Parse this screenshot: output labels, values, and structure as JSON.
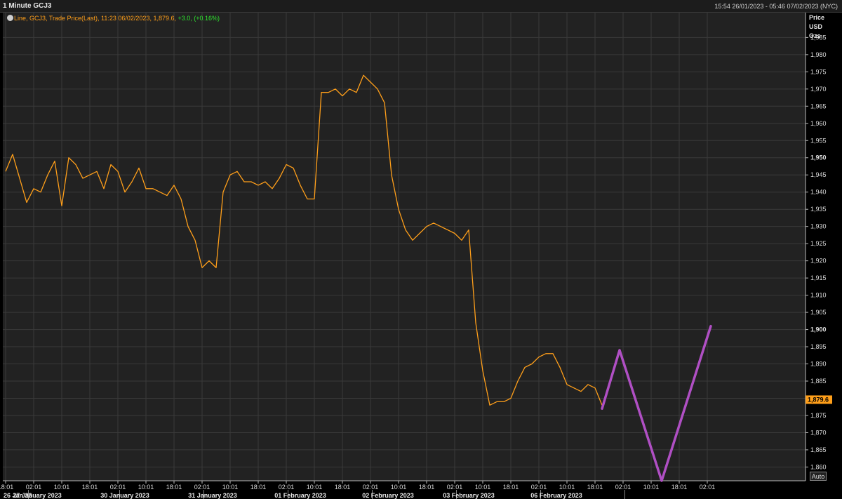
{
  "header": {
    "title": "1 Minute GCJ3",
    "time_range": "15:54 26/01/2023 - 05:46 07/02/2023 (NYC)"
  },
  "legend": {
    "icon": "chart-options-icon",
    "text": "Line, GCJ3, Trade Price(Last), 11:23 06/02/2023, 1,879.6,",
    "change": "+3.0, (+0.16%)"
  },
  "axis_header": {
    "line1": "Price",
    "line2": "USD",
    "line3": "Ozs"
  },
  "auto_label": "Auto",
  "colors": {
    "background": "#222222",
    "grid": "#3a3a3a",
    "series": "#ff9f1a",
    "annotation": "#b04fc4",
    "change_positive": "#2ee82e"
  },
  "chart_data": {
    "type": "line",
    "ylabel": "Price USD Ozs",
    "ylim": [
      1856,
      1991
    ],
    "grid": true,
    "last_value": 1879.6,
    "last_value_label": "1,879.6",
    "yticks": [
      {
        "v": 1860,
        "t": "1,860"
      },
      {
        "v": 1865,
        "t": "1,865"
      },
      {
        "v": 1870,
        "t": "1,870"
      },
      {
        "v": 1875,
        "t": "1,875"
      },
      {
        "v": 1880,
        "t": "1,880"
      },
      {
        "v": 1885,
        "t": "1,885"
      },
      {
        "v": 1890,
        "t": "1,890"
      },
      {
        "v": 1895,
        "t": "1,895"
      },
      {
        "v": 1900,
        "t": "1,900",
        "bold": true
      },
      {
        "v": 1905,
        "t": "1,905"
      },
      {
        "v": 1910,
        "t": "1,910"
      },
      {
        "v": 1915,
        "t": "1,915"
      },
      {
        "v": 1920,
        "t": "1,920"
      },
      {
        "v": 1925,
        "t": "1,925"
      },
      {
        "v": 1930,
        "t": "1,930"
      },
      {
        "v": 1935,
        "t": "1,935"
      },
      {
        "v": 1940,
        "t": "1,940"
      },
      {
        "v": 1945,
        "t": "1,945"
      },
      {
        "v": 1950,
        "t": "1,950",
        "bold": true
      },
      {
        "v": 1955,
        "t": "1,955"
      },
      {
        "v": 1960,
        "t": "1,960"
      },
      {
        "v": 1965,
        "t": "1,965"
      },
      {
        "v": 1970,
        "t": "1,970"
      },
      {
        "v": 1975,
        "t": "1,975"
      },
      {
        "v": 1980,
        "t": "1,980"
      },
      {
        "v": 1985,
        "t": "1,985"
      }
    ],
    "x_count": 114,
    "xticks": [
      {
        "i": 0,
        "t": "18:01"
      },
      {
        "i": 4,
        "t": "02:01"
      },
      {
        "i": 8,
        "t": "10:01"
      },
      {
        "i": 12,
        "t": "18:01"
      },
      {
        "i": 16,
        "t": "02:01"
      },
      {
        "i": 20,
        "t": "10:01"
      },
      {
        "i": 24,
        "t": "18:01"
      },
      {
        "i": 28,
        "t": "02:01"
      },
      {
        "i": 32,
        "t": "10:01"
      },
      {
        "i": 36,
        "t": "18:01"
      },
      {
        "i": 40,
        "t": "02:01"
      },
      {
        "i": 44,
        "t": "10:01"
      },
      {
        "i": 48,
        "t": "18:01"
      },
      {
        "i": 52,
        "t": "02:01"
      },
      {
        "i": 56,
        "t": "10:01"
      },
      {
        "i": 60,
        "t": "18:01"
      },
      {
        "i": 64,
        "t": "02:01"
      },
      {
        "i": 68,
        "t": "10:01"
      },
      {
        "i": 72,
        "t": "18:01"
      },
      {
        "i": 76,
        "t": "02:01"
      },
      {
        "i": 80,
        "t": "10:01"
      },
      {
        "i": 84,
        "t": "18:01"
      },
      {
        "i": 88,
        "t": "02:01"
      },
      {
        "i": 92,
        "t": "10:01"
      },
      {
        "i": 96,
        "t": "18:01"
      },
      {
        "i": 100,
        "t": "02:01"
      }
    ],
    "date_labels": [
      {
        "i": 0,
        "t": "26 Jan 23"
      },
      {
        "i": 4.5,
        "t": "27 January 2023"
      },
      {
        "i": 17,
        "t": "30 January 2023"
      },
      {
        "i": 29.5,
        "t": "31 January 2023"
      },
      {
        "i": 42,
        "t": "01 February 2023"
      },
      {
        "i": 54.5,
        "t": "02 February 2023"
      },
      {
        "i": 66,
        "t": "03 February 2023"
      },
      {
        "i": 78.5,
        "t": "06 February 2023"
      }
    ],
    "date_separators": [
      3,
      16,
      28,
      40,
      52,
      64,
      76,
      88
    ],
    "series": [
      {
        "x": [
          0,
          1,
          2,
          3,
          4,
          5,
          6,
          7,
          8,
          9,
          10,
          11,
          12,
          13,
          14,
          15,
          16,
          17,
          18,
          19,
          20,
          21,
          22,
          23,
          24,
          25,
          26,
          27,
          28,
          29,
          30,
          31,
          32,
          33,
          34,
          35,
          36,
          37,
          38,
          39,
          40,
          41,
          42,
          43,
          44,
          45,
          46,
          47,
          48,
          49,
          50,
          51,
          52,
          53,
          54,
          55,
          56,
          57,
          58,
          59,
          60,
          61,
          62,
          63,
          64,
          65,
          66,
          67,
          68,
          69,
          70,
          71,
          72,
          73,
          74,
          75,
          76,
          77,
          78,
          79,
          80,
          81,
          82,
          83,
          84,
          85
        ],
        "values": [
          1946,
          1951,
          1944,
          1937,
          1941,
          1940,
          1945,
          1949,
          1936,
          1950,
          1948,
          1944,
          1945,
          1946,
          1941,
          1948,
          1946,
          1940,
          1943,
          1947,
          1941,
          1941,
          1940,
          1939,
          1942,
          1938,
          1930,
          1926,
          1918,
          1920,
          1918,
          1940,
          1945,
          1946,
          1943,
          1943,
          1942,
          1943,
          1941,
          1944,
          1948,
          1947,
          1942,
          1938,
          1938,
          1969,
          1969,
          1970,
          1968,
          1970,
          1969,
          1974,
          1972,
          1970,
          1966,
          1945,
          1935,
          1929,
          1926,
          1928,
          1930,
          1931,
          1930,
          1929,
          1928,
          1926,
          1929,
          1902,
          1888,
          1878,
          1879,
          1879,
          1880,
          1885,
          1889,
          1890,
          1892,
          1893,
          1893,
          1889,
          1884,
          1883,
          1882,
          1884,
          1883,
          1878
        ]
      }
    ]
  },
  "annotation": {
    "type": "hand-drawn-zigzag",
    "points": [
      [
        85,
        1877
      ],
      [
        87.5,
        1894
      ],
      [
        93.5,
        1856
      ],
      [
        100.5,
        1901
      ]
    ]
  }
}
